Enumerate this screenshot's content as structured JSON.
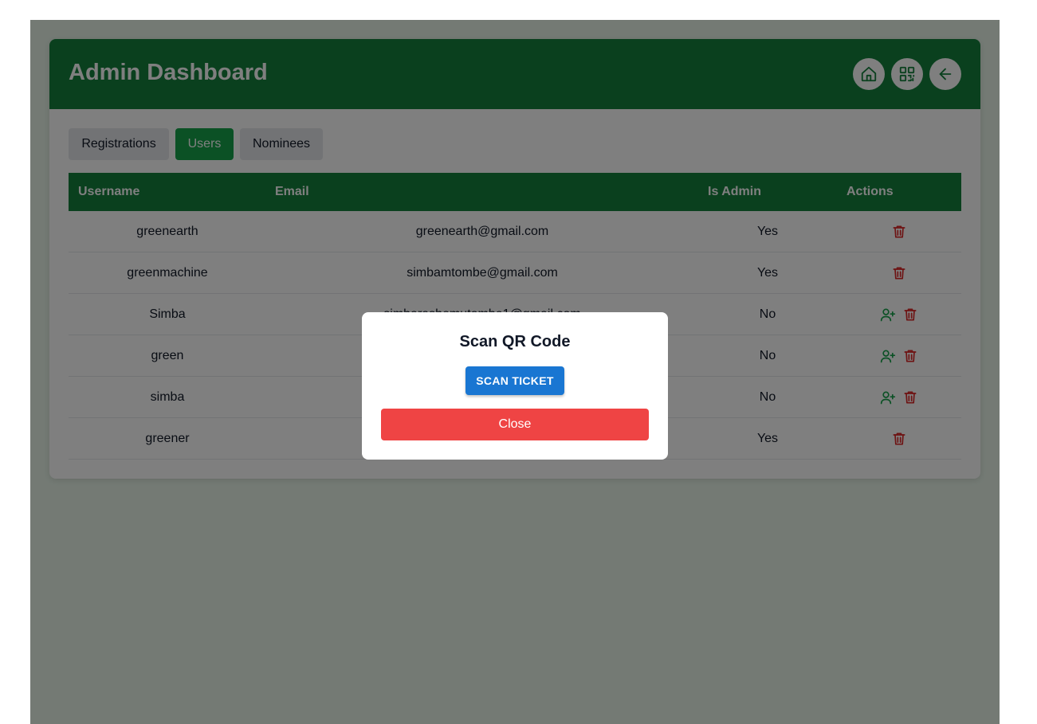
{
  "header": {
    "title": "Admin Dashboard",
    "buttons": [
      {
        "icon": "home-icon"
      },
      {
        "icon": "qr-code-icon"
      },
      {
        "icon": "arrow-left-icon"
      }
    ]
  },
  "tabs": [
    {
      "label": "Registrations",
      "active": false
    },
    {
      "label": "Users",
      "active": true
    },
    {
      "label": "Nominees",
      "active": false
    }
  ],
  "table": {
    "headers": {
      "username": "Username",
      "email": "Email",
      "is_admin": "Is Admin",
      "actions": "Actions"
    },
    "rows": [
      {
        "username": "greenearth",
        "email": "greenearth@gmail.com",
        "is_admin": "Yes",
        "actions": [
          "delete-icon"
        ]
      },
      {
        "username": "greenmachine",
        "email": "simbamtombe@gmail.com",
        "is_admin": "Yes",
        "actions": [
          "delete-icon"
        ]
      },
      {
        "username": "Simba",
        "email": "simbarashemutombe1@gmail.com",
        "is_admin": "No",
        "actions": [
          "user-plus-icon",
          "delete-icon"
        ]
      },
      {
        "username": "green",
        "email": "",
        "is_admin": "No",
        "actions": [
          "user-plus-icon",
          "delete-icon"
        ]
      },
      {
        "username": "simba",
        "email": "",
        "is_admin": "No",
        "actions": [
          "user-plus-icon",
          "delete-icon"
        ]
      },
      {
        "username": "greener",
        "email": "",
        "is_admin": "Yes",
        "actions": [
          "delete-icon"
        ]
      }
    ]
  },
  "modal": {
    "title": "Scan QR Code",
    "scan_label": "SCAN TICKET",
    "close_label": "Close"
  },
  "colors": {
    "header_green": "#15803d",
    "tab_active": "#16a34a",
    "scan_blue": "#1976d2",
    "close_red": "#ef4444",
    "delete_red": "#dc2626",
    "add_admin_green": "#16a34a"
  }
}
